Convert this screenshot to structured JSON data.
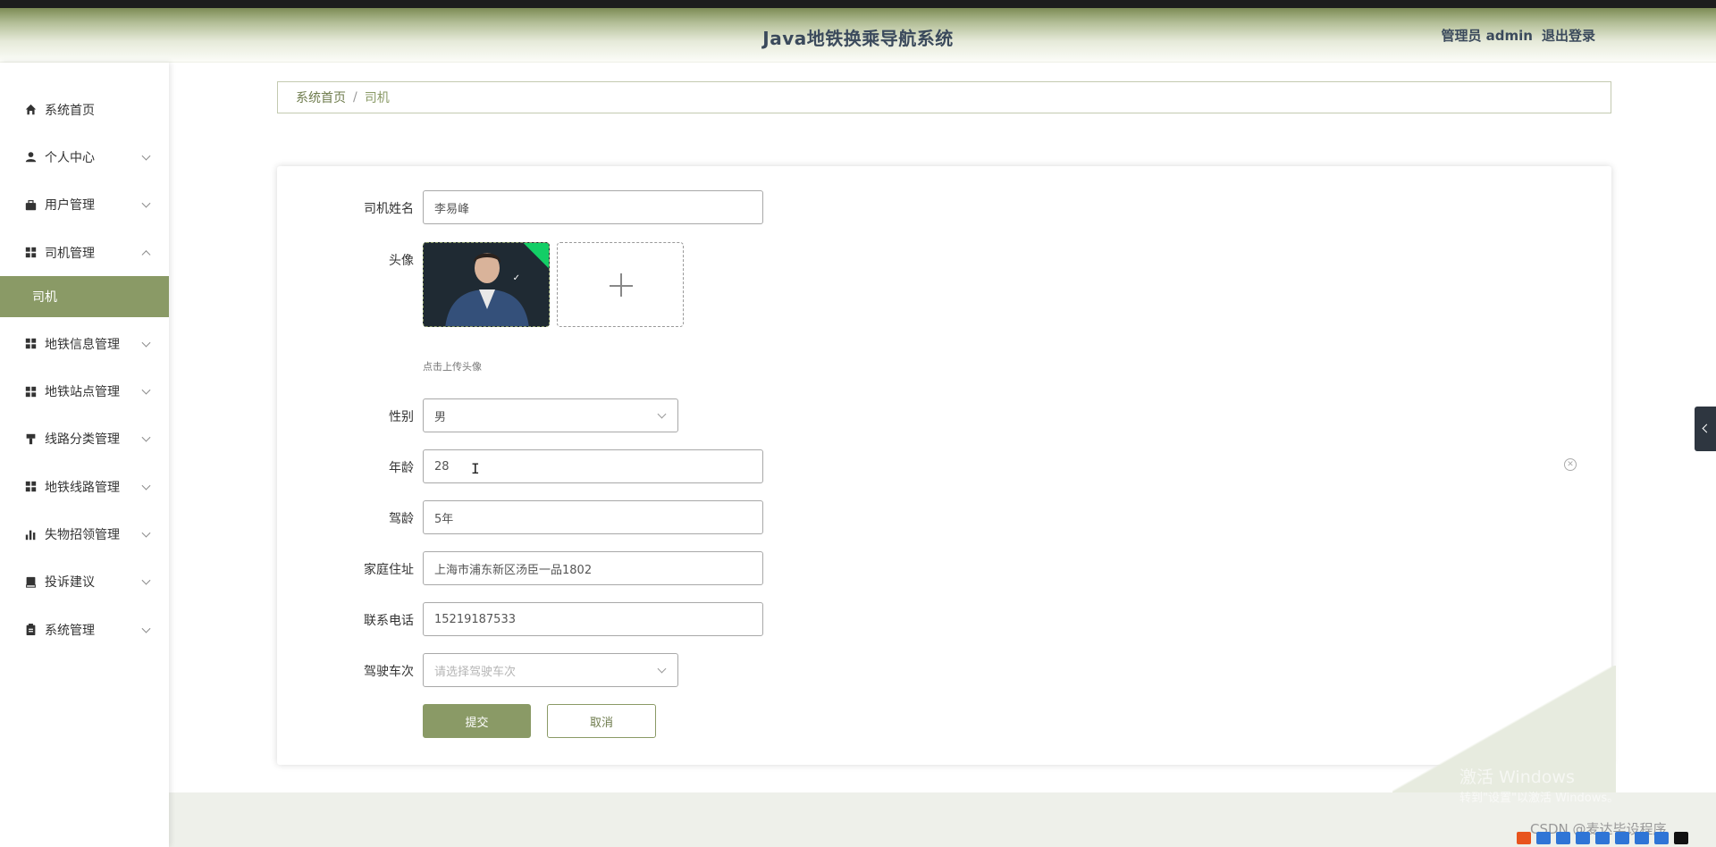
{
  "header": {
    "title": "Java地铁换乘导航系统",
    "user_role": "管理员 admin",
    "logout_label": "退出登录"
  },
  "sidebar": {
    "items": [
      {
        "label": "系统首页",
        "icon": "home-icon"
      },
      {
        "label": "个人中心",
        "icon": "user-icon"
      },
      {
        "label": "用户管理",
        "icon": "briefcase-icon"
      },
      {
        "label": "司机管理",
        "icon": "grid-icon",
        "expanded": true
      },
      {
        "label": "地铁信息管理",
        "icon": "grid-icon"
      },
      {
        "label": "地铁站点管理",
        "icon": "grid-icon"
      },
      {
        "label": "线路分类管理",
        "icon": "brush-icon"
      },
      {
        "label": "地铁线路管理",
        "icon": "grid-icon"
      },
      {
        "label": "失物招领管理",
        "icon": "bar-chart-icon"
      },
      {
        "label": "投诉建议",
        "icon": "book-icon"
      },
      {
        "label": "系统管理",
        "icon": "clipboard-icon"
      }
    ],
    "sub_item": "司机"
  },
  "breadcrumb": {
    "home": "系统首页",
    "separator": "/",
    "current": "司机"
  },
  "form": {
    "driver_name_label": "司机姓名",
    "driver_name_value": "李易峰",
    "avatar_label": "头像",
    "avatar_hint": "点击上传头像",
    "gender_label": "性别",
    "gender_value": "男",
    "age_label": "年龄",
    "age_value": "28",
    "driving_years_label": "驾龄",
    "driving_years_value": "5年",
    "address_label": "家庭住址",
    "address_value": "上海市浦东新区汤臣一品1802",
    "phone_label": "联系电话",
    "phone_value": "15219187533",
    "train_label": "驾驶车次",
    "train_placeholder": "请选择驾驶车次",
    "submit_label": "提交",
    "cancel_label": "取消"
  },
  "watermark": {
    "line1": "激活 Windows",
    "line2": "转到\"设置\"以激活 Windows。",
    "csdn": "CSDN @麦达毕设程序"
  },
  "colors": {
    "accent": "#8a9a66",
    "header_text": "#3b4a5c",
    "success_corner": "#13ce66"
  }
}
